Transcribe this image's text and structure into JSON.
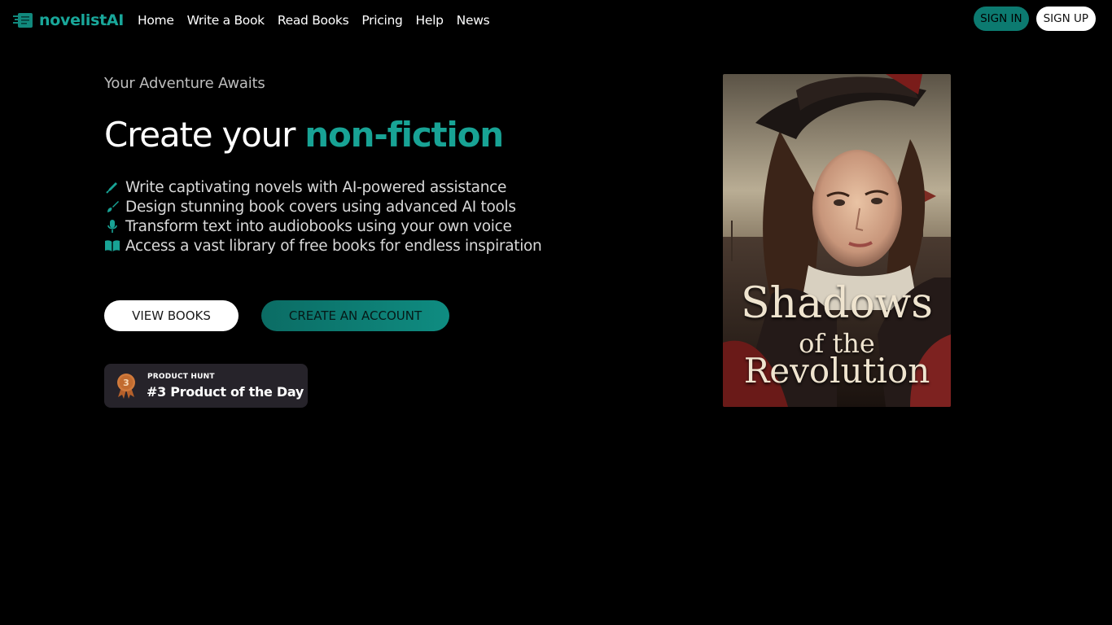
{
  "header": {
    "logo_text": "novelistAI",
    "nav": [
      {
        "label": "Home"
      },
      {
        "label": "Write a Book"
      },
      {
        "label": "Read Books"
      },
      {
        "label": "Pricing"
      },
      {
        "label": "Help"
      },
      {
        "label": "News"
      }
    ],
    "signin_label": "SIGN IN",
    "signup_label": "SIGN UP"
  },
  "hero": {
    "tagline": "Your Adventure Awaits",
    "headline_prefix": "Create your ",
    "headline_accent": "non-fiction",
    "features": [
      {
        "icon": "pen-icon",
        "text": "Write captivating novels with AI-powered assistance"
      },
      {
        "icon": "brush-icon",
        "text": "Design stunning book covers using advanced AI tools"
      },
      {
        "icon": "microphone-icon",
        "text": "Transform text into audiobooks using your own voice"
      },
      {
        "icon": "book-open-icon",
        "text": "Access a vast library of free books for endless inspiration"
      }
    ],
    "view_books_label": "VIEW BOOKS",
    "create_account_label": "CREATE AN ACCOUNT"
  },
  "product_hunt": {
    "rank": "3",
    "small_label": "PRODUCT HUNT",
    "big_label": "#3 Product of the Day"
  },
  "cover": {
    "title_line1": "Shadows",
    "title_line2": "of the",
    "title_line3": "Revolution"
  },
  "colors": {
    "accent": "#18a395",
    "background": "#000000",
    "badge_bg": "#26232a"
  }
}
